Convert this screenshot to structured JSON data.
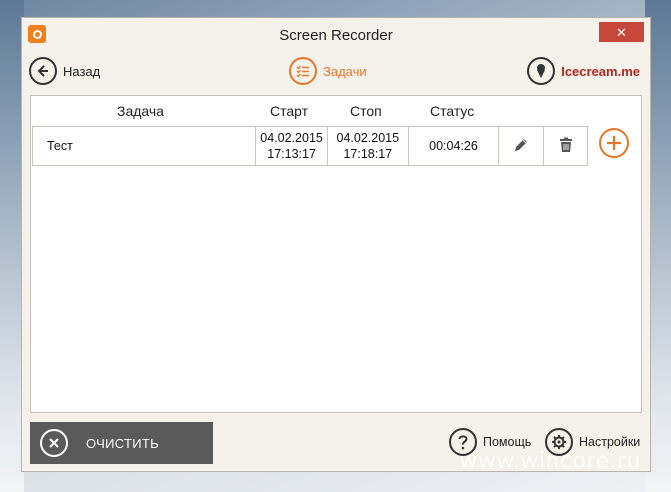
{
  "window": {
    "title": "Screen Recorder",
    "close_symbol": "✕"
  },
  "toolbar": {
    "back_label": "Назад",
    "tasks_label": "Задачи",
    "brand_label": "Icecream.me"
  },
  "table": {
    "columns": [
      "Задача",
      "Старт",
      "Стоп",
      "Статус"
    ],
    "rows": [
      {
        "name": "Тест",
        "start_date": "04.02.2015",
        "start_time": "17:13:17",
        "stop_date": "04.02.2015",
        "stop_time": "17:18:17",
        "status": "00:04:26"
      }
    ]
  },
  "footer": {
    "clear_label": "ОЧИСТИТЬ",
    "help_label": "Помощь",
    "settings_label": "Настройки"
  },
  "watermark": "www.wincore.ru",
  "colors": {
    "accent": "#e8762a",
    "brand": "#b3261e",
    "close": "#c7473a",
    "clear_bg": "#5a5a5a"
  }
}
